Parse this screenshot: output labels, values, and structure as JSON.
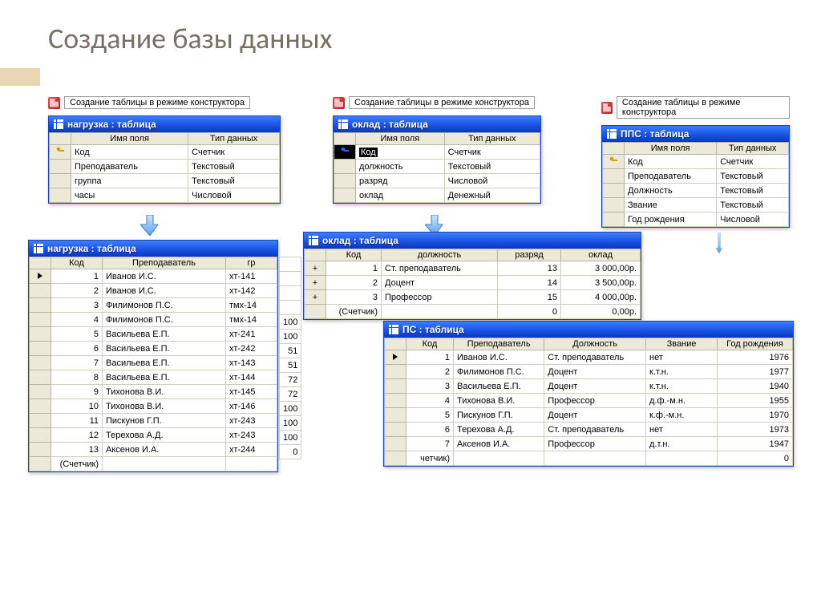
{
  "slide_title": "Создание базы данных",
  "create_label": "Создание таблицы в режиме конструктора",
  "design_cols": [
    "Имя поля",
    "Тип данных"
  ],
  "design1": {
    "title": "нагрузка : таблица",
    "rows": [
      {
        "k": true,
        "f": "Код",
        "t": "Счетчик"
      },
      {
        "k": false,
        "f": "Преподаватель",
        "t": "Текстовый"
      },
      {
        "k": false,
        "f": "группа",
        "t": "Текстовый"
      },
      {
        "k": false,
        "f": "часы",
        "t": "Числовой"
      }
    ]
  },
  "design2": {
    "title": "оклад : таблица",
    "rows": [
      {
        "k": true,
        "f": "Код",
        "t": "Счетчик"
      },
      {
        "k": false,
        "f": "должность",
        "t": "Текстовый"
      },
      {
        "k": false,
        "f": "разряд",
        "t": "Числовой"
      },
      {
        "k": false,
        "f": "оклад",
        "t": "Денежный"
      }
    ]
  },
  "design3": {
    "title": "ППС : таблица",
    "rows": [
      {
        "k": true,
        "f": "Код",
        "t": "Счетчик"
      },
      {
        "k": false,
        "f": "Преподаватель",
        "t": "Текстовый"
      },
      {
        "k": false,
        "f": "Должность",
        "t": "Текстовый"
      },
      {
        "k": false,
        "f": "Звание",
        "t": "Текстовый"
      },
      {
        "k": false,
        "f": "Год рождения",
        "t": "Числовой"
      }
    ]
  },
  "data1": {
    "title": "нагрузка : таблица",
    "cols": [
      "Код",
      "Преподаватель",
      "гр"
    ],
    "partial_col4": [
      "",
      "",
      "",
      "",
      "100",
      "100",
      "51",
      "51",
      "72",
      "72",
      "100",
      "100",
      "100",
      "0"
    ],
    "rows": [
      {
        "c1": "1",
        "c2": "Иванов И.С.",
        "c3": "хт-141"
      },
      {
        "c1": "2",
        "c2": "Иванов И.С.",
        "c3": "хт-142"
      },
      {
        "c1": "3",
        "c2": "Филимонов П.С.",
        "c3": "тмх-14"
      },
      {
        "c1": "4",
        "c2": "Филимонов П.С.",
        "c3": "тмх-14"
      },
      {
        "c1": "5",
        "c2": "Васильева Е.П.",
        "c3": "хт-241"
      },
      {
        "c1": "6",
        "c2": "Васильева Е.П.",
        "c3": "хт-242"
      },
      {
        "c1": "7",
        "c2": "Васильева Е.П.",
        "c3": "хт-143"
      },
      {
        "c1": "8",
        "c2": "Васильева Е.П.",
        "c3": "хт-144"
      },
      {
        "c1": "9",
        "c2": "Тихонова В.И.",
        "c3": "хт-145"
      },
      {
        "c1": "10",
        "c2": "Тихонова В.И.",
        "c3": "хт-146"
      },
      {
        "c1": "11",
        "c2": "Пискунов Г.П.",
        "c3": "хт-243"
      },
      {
        "c1": "12",
        "c2": "Терехова А.Д.",
        "c3": "хт-243"
      },
      {
        "c1": "13",
        "c2": "Аксенов И.А.",
        "c3": "хт-244"
      }
    ],
    "counter": "(Счетчик)"
  },
  "data2": {
    "title": "оклад : таблица",
    "cols": [
      "Код",
      "должность",
      "разряд",
      "оклад"
    ],
    "rows": [
      {
        "c1": "1",
        "c2": "Ст. преподаватель",
        "c3": "13",
        "c4": "3 000,00р."
      },
      {
        "c1": "2",
        "c2": "Доцент",
        "c3": "14",
        "c4": "3 500,00р."
      },
      {
        "c1": "3",
        "c2": "Профессор",
        "c3": "15",
        "c4": "4 000,00р."
      }
    ],
    "counter": "(Счетчик)",
    "zero_r": "0",
    "zero_m": "0,00р."
  },
  "data3": {
    "title": "ПС : таблица",
    "cols": [
      "Код",
      "Преподаватель",
      "Должность",
      "Звание",
      "Год рождения"
    ],
    "rows": [
      {
        "c1": "1",
        "c2": "Иванов И.С.",
        "c3": "Ст. преподаватель",
        "c4": "нет",
        "c5": "1976"
      },
      {
        "c1": "2",
        "c2": "Филимонов П.С.",
        "c3": "Доцент",
        "c4": "к.т.н.",
        "c5": "1977"
      },
      {
        "c1": "3",
        "c2": "Васильева Е.П.",
        "c3": "Доцент",
        "c4": "к.т.н.",
        "c5": "1940"
      },
      {
        "c1": "4",
        "c2": "Тихонова В.И.",
        "c3": "Профессор",
        "c4": "д.ф.-м.н.",
        "c5": "1955"
      },
      {
        "c1": "5",
        "c2": "Пискунов Г.П.",
        "c3": "Доцент",
        "c4": "к.ф.-м.н.",
        "c5": "1970"
      },
      {
        "c1": "6",
        "c2": "Терехова А.Д.",
        "c3": "Ст. преподаватель",
        "c4": "нет",
        "c5": "1973"
      },
      {
        "c1": "7",
        "c2": "Аксенов И.А.",
        "c3": "Профессор",
        "c4": "д.т.н.",
        "c5": "1947"
      }
    ],
    "counter": "четчик)",
    "zero": "0"
  }
}
